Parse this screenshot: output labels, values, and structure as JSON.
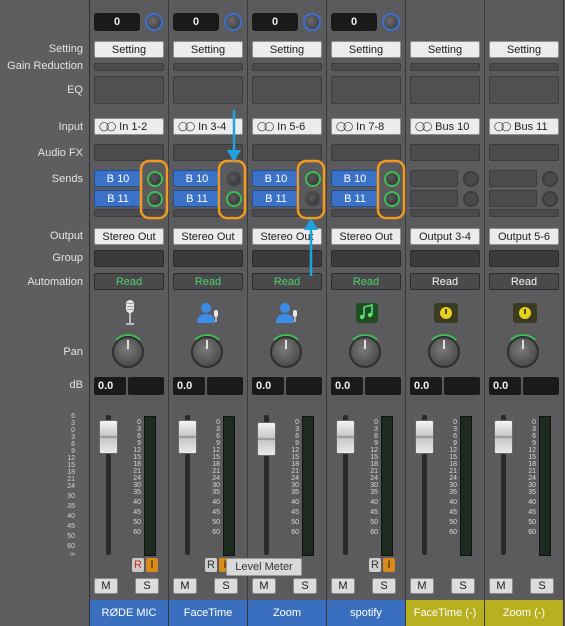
{
  "row_labels": {
    "setting": "Setting",
    "gain_reduction": "Gain Reduction",
    "eq": "EQ",
    "input": "Input",
    "audio_fx": "Audio FX",
    "sends": "Sends",
    "output": "Output",
    "group": "Group",
    "automation": "Automation",
    "pan": "Pan",
    "db": "dB"
  },
  "fader_scale": [
    "6",
    "3",
    "0",
    "3",
    "6",
    "9",
    "12",
    "15",
    "18",
    "21",
    "24",
    "30",
    "35",
    "40",
    "45",
    "50",
    "60",
    "∞"
  ],
  "meter_scale": [
    "0",
    "3",
    "6",
    "9",
    "12",
    "15",
    "18",
    "21",
    "24",
    "30",
    "35",
    "40",
    "45",
    "50",
    "60"
  ],
  "channels": [
    {
      "trim": "0",
      "setting": "Setting",
      "input": "In 1-2",
      "sends": [
        "B 10",
        "B 11"
      ],
      "output": "Stereo Out",
      "automation": "Read",
      "automation_color": "green",
      "icon": "microphone-icon",
      "db": "0.0",
      "rec": "R",
      "inp": "I",
      "mute": "M",
      "solo": "S",
      "name": "RØDE MIC",
      "name_color": "blue"
    },
    {
      "trim": "0",
      "setting": "Setting",
      "input": "In 3-4",
      "sends": [
        "B 10",
        "B 11"
      ],
      "output": "Stereo Out",
      "automation": "Read",
      "automation_color": "green",
      "icon": "person-mic-icon",
      "db": "0.0",
      "rec": "R",
      "inp": "I",
      "mute": "M",
      "solo": "S",
      "name": "FaceTime",
      "name_color": "blue"
    },
    {
      "trim": "0",
      "setting": "Setting",
      "input": "In 5-6",
      "sends": [
        "B 10",
        "B 11"
      ],
      "output": "Stereo Out",
      "automation": "Read",
      "automation_color": "green",
      "icon": "person-mic-icon",
      "db": "0.0",
      "rec": "",
      "inp": "",
      "mute": "M",
      "solo": "S",
      "name": "Zoom",
      "name_color": "blue"
    },
    {
      "trim": "0",
      "setting": "Setting",
      "input": "In 7-8",
      "sends": [
        "B 10",
        "B 11"
      ],
      "output": "Stereo Out",
      "automation": "Read",
      "automation_color": "green",
      "icon": "music-note-icon",
      "db": "0.0",
      "rec": "R",
      "inp": "I",
      "mute": "M",
      "solo": "S",
      "name": "spotify",
      "name_color": "blue"
    },
    {
      "trim": "",
      "setting": "Setting",
      "input": "Bus 10",
      "sends": [],
      "output": "Output 3-4",
      "automation": "Read",
      "automation_color": "white",
      "icon": "aux-meter-icon",
      "db": "0.0",
      "rec": "",
      "inp": "",
      "mute": "M",
      "solo": "S",
      "name": "FaceTime (-)",
      "name_color": "yellow"
    },
    {
      "trim": "",
      "setting": "Setting",
      "input": "Bus 11",
      "sends": [],
      "output": "Output 5-6",
      "automation": "Read",
      "automation_color": "white",
      "icon": "aux-meter-icon",
      "db": "0.0",
      "rec": "",
      "inp": "",
      "mute": "M",
      "solo": "S",
      "name": "Zoom (-)",
      "name_color": "yellow"
    }
  ],
  "tooltip": "Level Meter",
  "colors": {
    "highlight": "#f29a1f",
    "arrow": "#1fa3e0",
    "send_blue": "#3a72c8",
    "aux_yellow": "#b8b01e",
    "read_green": "#4ed16a"
  }
}
